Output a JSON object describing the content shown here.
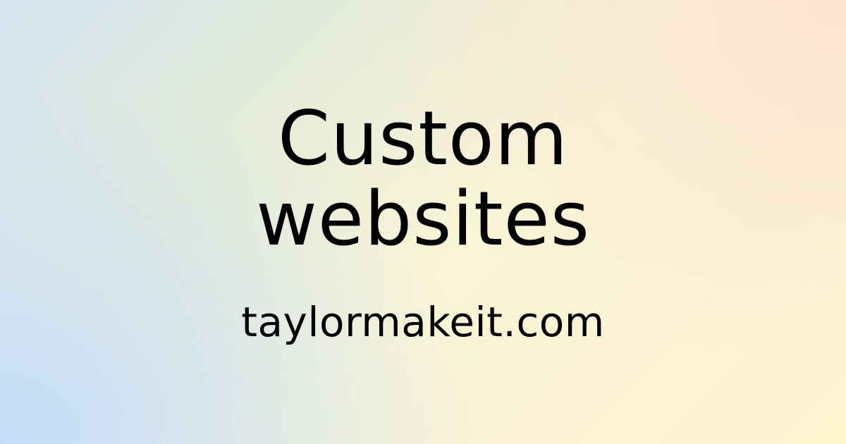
{
  "headline": {
    "line1": "Custom",
    "line2": "websites"
  },
  "domain": "taylormakeit.com",
  "colors": {
    "text": "#000000",
    "gradient_blue": "#c4dcfa",
    "gradient_yellow": "#fbf3d3",
    "gradient_peach": "#fae4d2"
  }
}
